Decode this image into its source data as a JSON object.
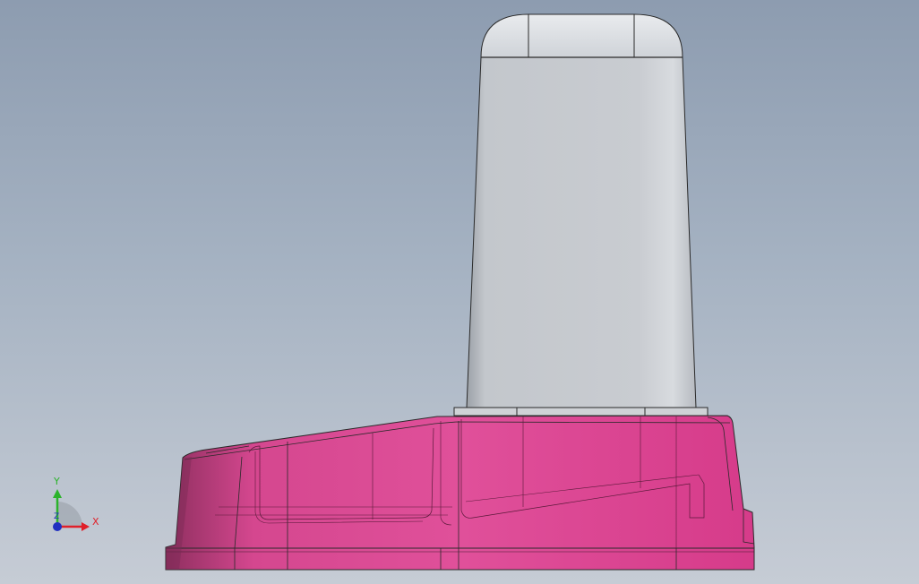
{
  "viewport": {
    "background_top": "#8d9cb0",
    "background_bottom": "#c6ccd5"
  },
  "model": {
    "cap_color": "#c2c6cc",
    "base_color": "#e0509a",
    "base_shadow": "#b02d73",
    "edge_color": "#1e1e1e"
  },
  "triad": {
    "x_label": "X",
    "y_label": "Y",
    "z_label": "Z",
    "x_color": "#e0202a",
    "y_color": "#2bb32b",
    "z_color": "#2030c0"
  }
}
